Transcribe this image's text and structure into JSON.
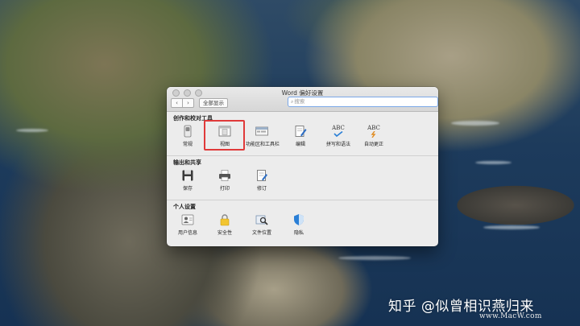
{
  "window": {
    "title": "Word 偏好设置",
    "nav_back": "‹",
    "nav_forward": "›",
    "show_all": "全部显示",
    "search_placeholder": "搜索"
  },
  "sections": [
    {
      "title": "创作和校对工具",
      "items": [
        {
          "label": "常规",
          "icon": "switch-icon"
        },
        {
          "label": "视图",
          "icon": "view-icon"
        },
        {
          "label": "功能区和工具栏",
          "icon": "ribbon-icon"
        },
        {
          "label": "编辑",
          "icon": "edit-icon"
        },
        {
          "label": "拼写和语法",
          "icon": "spelling-icon",
          "glyph": "ABC"
        },
        {
          "label": "自动更正",
          "icon": "autocorrect-icon",
          "glyph": "ABC"
        }
      ]
    },
    {
      "title": "输出和共享",
      "items": [
        {
          "label": "保存",
          "icon": "save-icon"
        },
        {
          "label": "打印",
          "icon": "print-icon"
        },
        {
          "label": "修订",
          "icon": "track-changes-icon"
        }
      ]
    },
    {
      "title": "个人设置",
      "items": [
        {
          "label": "用户信息",
          "icon": "user-info-icon"
        },
        {
          "label": "安全性",
          "icon": "lock-icon"
        },
        {
          "label": "文件位置",
          "icon": "file-location-icon"
        },
        {
          "label": "隐私",
          "icon": "privacy-shield-icon"
        }
      ]
    }
  ],
  "watermark": {
    "line1": "知乎 @似曾相识燕归来",
    "line2": "www.MacW.com"
  },
  "colors": {
    "highlight": "#e03a3a",
    "search_focus": "#7aa7e8",
    "shield_blue": "#2a7fd6",
    "lock_yellow": "#f2c531"
  }
}
